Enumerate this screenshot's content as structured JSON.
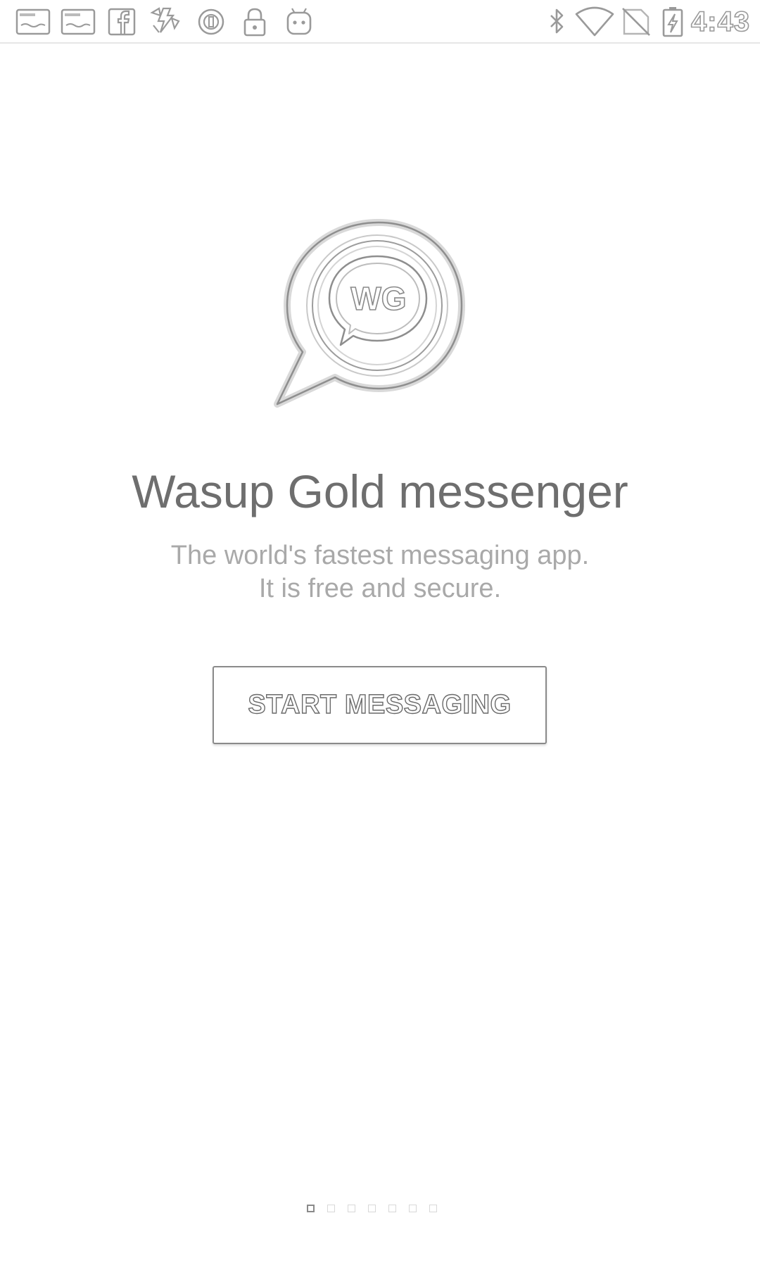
{
  "status_bar": {
    "time": "4:43",
    "notification_icons": [
      "sms-app-icon",
      "sms-app-icon",
      "facebook-icon",
      "app-icon",
      "circle-app-icon",
      "lock-icon",
      "android-icon"
    ],
    "system_icons": [
      "bluetooth-icon",
      "wifi-icon",
      "no-signal-icon",
      "battery-charging-icon"
    ]
  },
  "logo": {
    "monogram": "WG"
  },
  "main": {
    "app_name": "Wasup Gold messenger",
    "tagline_line1": "The world's fastest messaging app.",
    "tagline_line2": "It is free and secure.",
    "start_button_label": "START MESSAGING"
  },
  "pager": {
    "total_pages": 7,
    "current_page": 1
  }
}
